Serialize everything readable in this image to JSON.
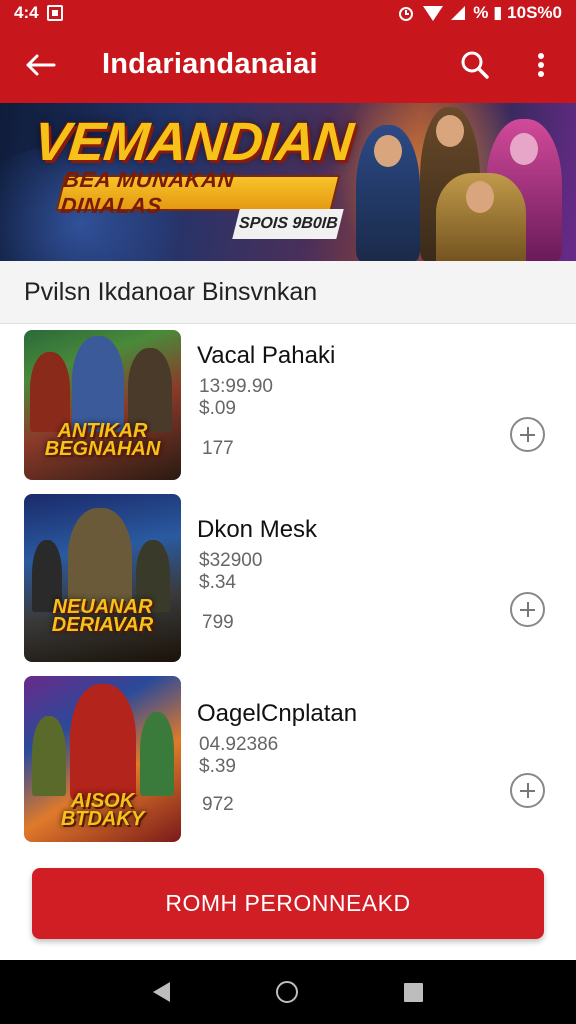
{
  "status_bar": {
    "time": "4:4",
    "right_text": "% ▮ 10S%0"
  },
  "app_bar": {
    "title": "Indariandanaiai",
    "back_icon": "arrow-left-icon",
    "search_icon": "search-icon",
    "more_icon": "more-vert-icon"
  },
  "banner": {
    "title": "VEMANDIAN",
    "subtitle": "BEA MUNAKAN DINALAS",
    "tag": "SPOIS 9B0IB"
  },
  "section": {
    "heading": "Pvilsn Ikdanoar Binsvnkan"
  },
  "items": [
    {
      "name": "Vacal Pahaki",
      "price": "13:99.90",
      "sub": "$.09",
      "count": "177",
      "thumb_title": "ANTIKAR BEGNAHAN",
      "add_icon": "plus-circle-icon"
    },
    {
      "name": "Dkon Mesk",
      "price": "$32900",
      "sub": "$.34",
      "count": "799",
      "thumb_title": "NEUANAR DERIAVAR",
      "add_icon": "plus-circle-icon"
    },
    {
      "name": "OagelCnplatan",
      "price": "04.92386",
      "sub": "$.39",
      "count": "972",
      "thumb_title": "AISOK BTDAKY",
      "add_icon": "plus-circle-icon"
    }
  ],
  "cta": {
    "label": "ROMH PERONNEAKD"
  },
  "nav_bar": {
    "back_icon": "nav-back-icon",
    "home_icon": "nav-home-icon",
    "recent_icon": "nav-recents-icon"
  },
  "colors": {
    "primary": "#c8161d",
    "cta": "#d11d24",
    "banner_gold": "#f6c21a"
  }
}
